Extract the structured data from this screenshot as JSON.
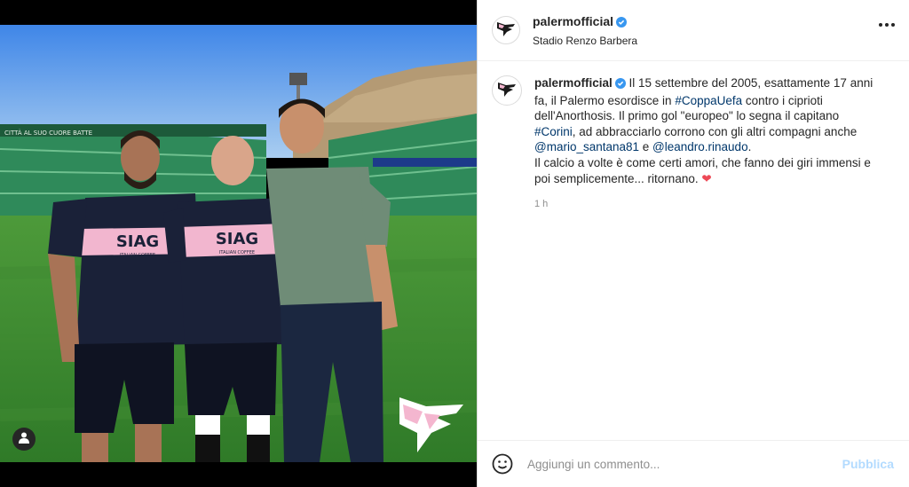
{
  "post": {
    "username": "palermofficial",
    "location": "Stadio Renzo Barbera",
    "verified": true
  },
  "photo": {
    "sponsor_main": "SIAG",
    "sponsor_sub": "ITALIAN COFFEE",
    "stadium_banner": "CITTÀ AL SUO CUORE BATTE"
  },
  "caption": {
    "username": "palermofficial",
    "p1": " Il 15 settembre del 2005, esattamente 17 anni fa, il Palermo esordisce in ",
    "tag_coppa": "#CoppaUefa",
    "p2": " contro i ciprioti dell'Anorthosis. Il primo gol \"europeo\" lo segna il capitano ",
    "tag_corini": "#Corini",
    "p3": ", ad abbracciarlo corrono con gli altri compagni anche ",
    "tag_santana": "@mario_santana81",
    "p4": " e ",
    "tag_rinaudo": "@leandro.rinaudo",
    "p5": ".",
    "p6": "Il calcio a volte è come certi amori, che fanno dei giri immensi e poi semplicemente... ritornano. ",
    "heart": "❤",
    "time": "1 h"
  },
  "comment_bar": {
    "placeholder": "Aggiungi un commento...",
    "publish_label": "Pubblica"
  },
  "icons": {
    "verified": "verified-badge-icon",
    "more": "more-options-icon",
    "emoji": "emoji-icon",
    "user_tag": "user-tag-icon"
  },
  "colors": {
    "link": "#00376b",
    "verified": "#3897f0",
    "publish_disabled": "#b3dbff",
    "heart": "#ed4956",
    "palermo_pink": "#f4b6cf"
  }
}
